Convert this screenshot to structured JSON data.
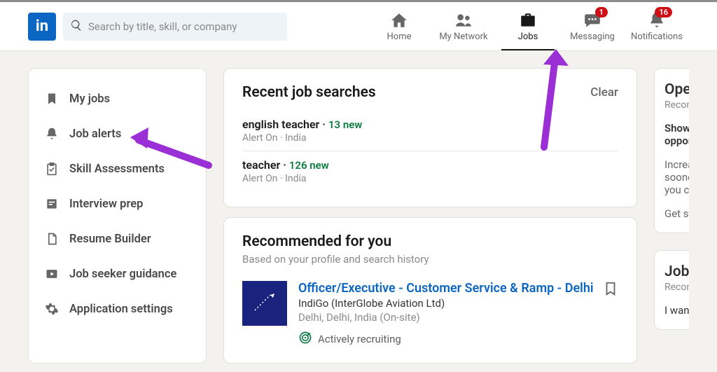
{
  "header": {
    "logo_text": "in",
    "search_placeholder": "Search by title, skill, or company"
  },
  "nav": {
    "home": "Home",
    "network": "My Network",
    "jobs": "Jobs",
    "messaging_label": "Messaging",
    "messaging_badge": "1",
    "notifications_label": "Notifications",
    "notifications_badge": "16"
  },
  "sidebar": {
    "my_jobs": "My jobs",
    "job_alerts": "Job alerts",
    "skill_assessments": "Skill Assessments",
    "interview_prep": "Interview prep",
    "resume_builder": "Resume Builder",
    "job_seeker_guidance": "Job seeker guidance",
    "application_settings": "Application settings"
  },
  "recent": {
    "title": "Recent job searches",
    "clear": "Clear",
    "items": [
      {
        "term": "english teacher",
        "sep": " · ",
        "new": "13 new",
        "sub": "Alert On · India"
      },
      {
        "term": "teacher",
        "sep": " · ",
        "new": "126 new",
        "sub": "Alert On · India"
      }
    ]
  },
  "recommended": {
    "title": "Recommended for you",
    "subtitle": "Based on your profile and search history",
    "job": {
      "title": "Officer/Executive - Customer Service & Ramp - Delhi",
      "company": "IndiGo (InterGlobe Aviation Ltd)",
      "location": "Delhi, Delhi, India (On-site)",
      "recruiting": "Actively recruiting"
    }
  },
  "rightcol": {
    "opentowork_title": "Open to work",
    "opentowork_sub": "Recommended",
    "show_recruiters": "Show recruiters you're open to new opportunities",
    "increase": "Increase your chances of getting a job sooner when you're #OpenToWork — you control who sees this.",
    "get_started": "Get started",
    "seeker_title": "Job seeker guidance",
    "seeker_sub": "Recommended",
    "want": "I want to improve my resume"
  }
}
